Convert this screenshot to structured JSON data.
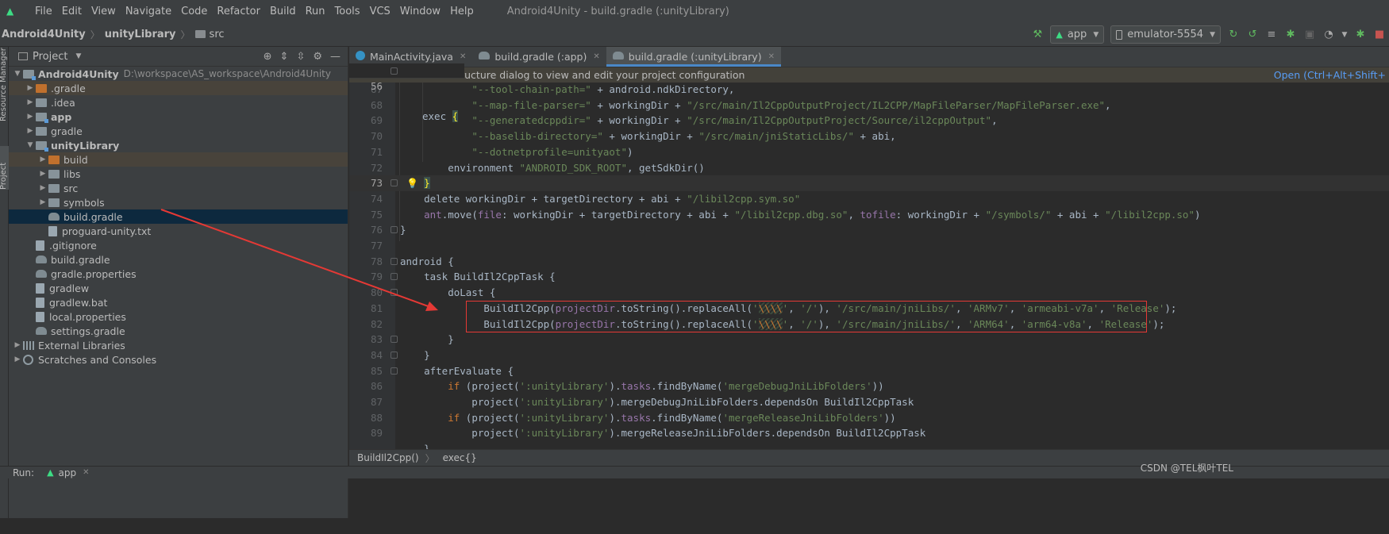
{
  "menubar": {
    "items": [
      "File",
      "Edit",
      "View",
      "Navigate",
      "Code",
      "Refactor",
      "Build",
      "Run",
      "Tools",
      "VCS",
      "Window",
      "Help"
    ],
    "window_title": "Android4Unity - build.gradle (:unityLibrary)"
  },
  "navbar": {
    "crumbs": [
      "Android4Unity",
      "unityLibrary",
      "src"
    ],
    "run_config": "app",
    "device": "emulator-5554"
  },
  "left_stripe": {
    "tabs": [
      "Resource Manager",
      "Project"
    ]
  },
  "project_panel": {
    "title": "Project",
    "tree": [
      {
        "label": "Android4Unity",
        "path": "D:\\workspace\\AS_workspace\\Android4Unity",
        "bold": true,
        "depth": 0,
        "arrow": "down",
        "icon": "module-folder"
      },
      {
        "label": ".gradle",
        "depth": 1,
        "arrow": "right",
        "icon": "orange-folder",
        "excluded": true
      },
      {
        "label": ".idea",
        "depth": 1,
        "arrow": "right",
        "icon": "folder"
      },
      {
        "label": "app",
        "depth": 1,
        "arrow": "right",
        "icon": "module-folder",
        "bold": true
      },
      {
        "label": "gradle",
        "depth": 1,
        "arrow": "right",
        "icon": "folder"
      },
      {
        "label": "unityLibrary",
        "depth": 1,
        "arrow": "down",
        "icon": "module-folder",
        "bold": true
      },
      {
        "label": "build",
        "depth": 2,
        "arrow": "right",
        "icon": "orange-folder",
        "excluded": true
      },
      {
        "label": "libs",
        "depth": 2,
        "arrow": "right",
        "icon": "folder"
      },
      {
        "label": "src",
        "depth": 2,
        "arrow": "right",
        "icon": "folder"
      },
      {
        "label": "symbols",
        "depth": 2,
        "arrow": "right",
        "icon": "folder"
      },
      {
        "label": "build.gradle",
        "depth": 2,
        "arrow": "none",
        "icon": "gradle-elephant",
        "selected": true
      },
      {
        "label": "proguard-unity.txt",
        "depth": 2,
        "arrow": "none",
        "icon": "file"
      },
      {
        "label": ".gitignore",
        "depth": 1,
        "arrow": "none",
        "icon": "file"
      },
      {
        "label": "build.gradle",
        "depth": 1,
        "arrow": "none",
        "icon": "gradle-elephant"
      },
      {
        "label": "gradle.properties",
        "depth": 1,
        "arrow": "none",
        "icon": "gradle-elephant"
      },
      {
        "label": "gradlew",
        "depth": 1,
        "arrow": "none",
        "icon": "file"
      },
      {
        "label": "gradlew.bat",
        "depth": 1,
        "arrow": "none",
        "icon": "file"
      },
      {
        "label": "local.properties",
        "depth": 1,
        "arrow": "none",
        "icon": "file"
      },
      {
        "label": "settings.gradle",
        "depth": 1,
        "arrow": "none",
        "icon": "gradle-elephant"
      },
      {
        "label": "External Libraries",
        "depth": 0,
        "arrow": "right",
        "icon": "libs"
      },
      {
        "label": "Scratches and Consoles",
        "depth": 0,
        "arrow": "right",
        "icon": "scratch"
      }
    ]
  },
  "editor_tabs": [
    {
      "label": "MainActivity.java",
      "icon": "java",
      "active": false
    },
    {
      "label": "build.gradle (:app)",
      "icon": "gradle",
      "active": false
    },
    {
      "label": "build.gradle (:unityLibrary)",
      "icon": "gradle",
      "active": true
    }
  ],
  "notification": {
    "text": "ructure dialog to view and edit your project configuration",
    "link": "Open (Ctrl+Alt+Shift+"
  },
  "sticky": {
    "line": "56",
    "code": "exec {"
  },
  "code_lines": [
    {
      "n": "67",
      "html": "            <span class='str'>\"--tool-chain-path=\"</span> + android.ndkDirectory,"
    },
    {
      "n": "68",
      "html": "            <span class='str'>\"--map-file-parser=\"</span> + workingDir + <span class='str'>\"/src/main/Il2CppOutputProject/IL2CPP/MapFileParser/MapFileParser.exe\"</span>,"
    },
    {
      "n": "69",
      "html": "            <span class='str'>\"--generatedcppdir=\"</span> + workingDir + <span class='str'>\"/src/main/Il2CppOutputProject/Source/il2cppOutput\"</span>,"
    },
    {
      "n": "70",
      "html": "            <span class='str'>\"--baselib-directory=\"</span> + workingDir + <span class='str'>\"/src/main/jniStaticLibs/\"</span> + abi,"
    },
    {
      "n": "71",
      "html": "            <span class='str'>\"--dotnetprofile=unityaot\"</span>)"
    },
    {
      "n": "72",
      "html": "        environment <span class='str'>\"ANDROID_SDK_ROOT\"</span>, getSdkDir()"
    },
    {
      "n": "73",
      "html": "    <span class='bracket'>}</span>",
      "current": true
    },
    {
      "n": "74",
      "html": "    delete workingDir + targetDirectory + abi + <span class='str'>\"/libil2cpp.sym.so\"</span>"
    },
    {
      "n": "75",
      "html": "    <span class='prop'>ant</span>.move(<span class='prop'>file</span>: workingDir + targetDirectory + abi + <span class='str'>\"/libil2cpp.dbg.so\"</span>, <span class='prop'>tofile</span>: workingDir + <span class='str'>\"/symbols/\"</span> + abi + <span class='str'>\"/libil2cpp.so\"</span>)"
    },
    {
      "n": "76",
      "html": "}"
    },
    {
      "n": "77",
      "html": ""
    },
    {
      "n": "78",
      "html": "android {"
    },
    {
      "n": "79",
      "html": "    task BuildIl2CppTask {"
    },
    {
      "n": "80",
      "html": "        doLast {"
    },
    {
      "n": "81",
      "html": "              BuildIl2Cpp(<span class='prop'>projectDir</span>.toString().replaceAll(<span class='str'>'</span><span class='esc'>\\\\\\\\</span><span class='str'>'</span>, <span class='str'>'/'</span>), <span class='str'>'/src/main/jniLibs/'</span>, <span class='str'>'ARMv7'</span>, <span class='str'>'armeabi-v7a'</span>, <span class='str'>'Release'</span>);"
    },
    {
      "n": "82",
      "html": "              BuildIl2Cpp(<span class='prop'>projectDir</span>.toString().replaceAll(<span class='str'>'</span><span class='esc'>\\\\\\\\</span><span class='str'>'</span>, <span class='str'>'/'</span>), <span class='str'>'/src/main/jniLibs/'</span>, <span class='str'>'ARM64'</span>, <span class='str'>'arm64-v8a'</span>, <span class='str'>'Release'</span>);"
    },
    {
      "n": "83",
      "html": "        }"
    },
    {
      "n": "84",
      "html": "    }"
    },
    {
      "n": "85",
      "html": "    afterEvaluate {"
    },
    {
      "n": "86",
      "html": "        <span class='kw'>if</span> (project(<span class='str'>':unityLibrary'</span>).<span class='prop'>tasks</span>.findByName(<span class='str'>'mergeDebugJniLibFolders'</span>))"
    },
    {
      "n": "87",
      "html": "            project(<span class='str'>':unityLibrary'</span>).mergeDebugJniLibFolders.dependsOn BuildIl2CppTask"
    },
    {
      "n": "88",
      "html": "        <span class='kw'>if</span> (project(<span class='str'>':unityLibrary'</span>).<span class='prop'>tasks</span>.findByName(<span class='str'>'mergeReleaseJniLibFolders'</span>))"
    },
    {
      "n": "89",
      "html": "            project(<span class='str'>':unityLibrary'</span>).mergeReleaseJniLibFolders.dependsOn BuildIl2CppTask"
    },
    {
      "n": "",
      "html": "    }"
    }
  ],
  "code_crumbs": [
    "BuildIl2Cpp()",
    "exec{}"
  ],
  "runbar": {
    "label": "Run:",
    "app": "app"
  },
  "watermark": "CSDN @TEL枫叶TEL",
  "colors": {
    "accent": "#4a88c7",
    "annotation": "#e53935",
    "selection": "#0d293e"
  }
}
